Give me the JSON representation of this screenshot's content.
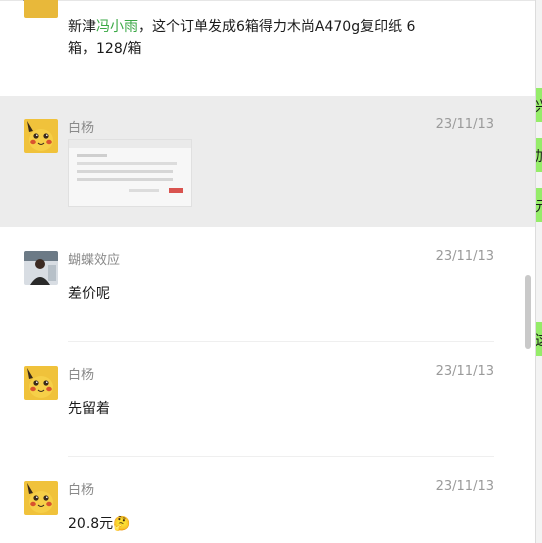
{
  "top_message": {
    "line1_pre": "新津",
    "line1_mention": "冯小雨",
    "line1_post": "，这个订单发成6箱得力木尚A470g复印纸  6",
    "line2": "箱，128/箱"
  },
  "messages": [
    {
      "name": "白杨",
      "time": "23/11/13",
      "type": "image"
    },
    {
      "name": "蝴蝶效应",
      "time": "23/11/13",
      "text": "差价呢"
    },
    {
      "name": "白杨",
      "time": "23/11/13",
      "text": "先留着"
    },
    {
      "name": "白杨",
      "time": "23/11/13",
      "text": "20.8元",
      "emoji": "🤔"
    }
  ],
  "right_bubbles": [
    "兴",
    "加",
    "元",
    "这"
  ],
  "colors": {
    "mention": "#3aa845",
    "highlight_bg": "#ececec",
    "right_bubble": "#95ec69"
  },
  "icons": {
    "back": "chevron-left-icon"
  }
}
